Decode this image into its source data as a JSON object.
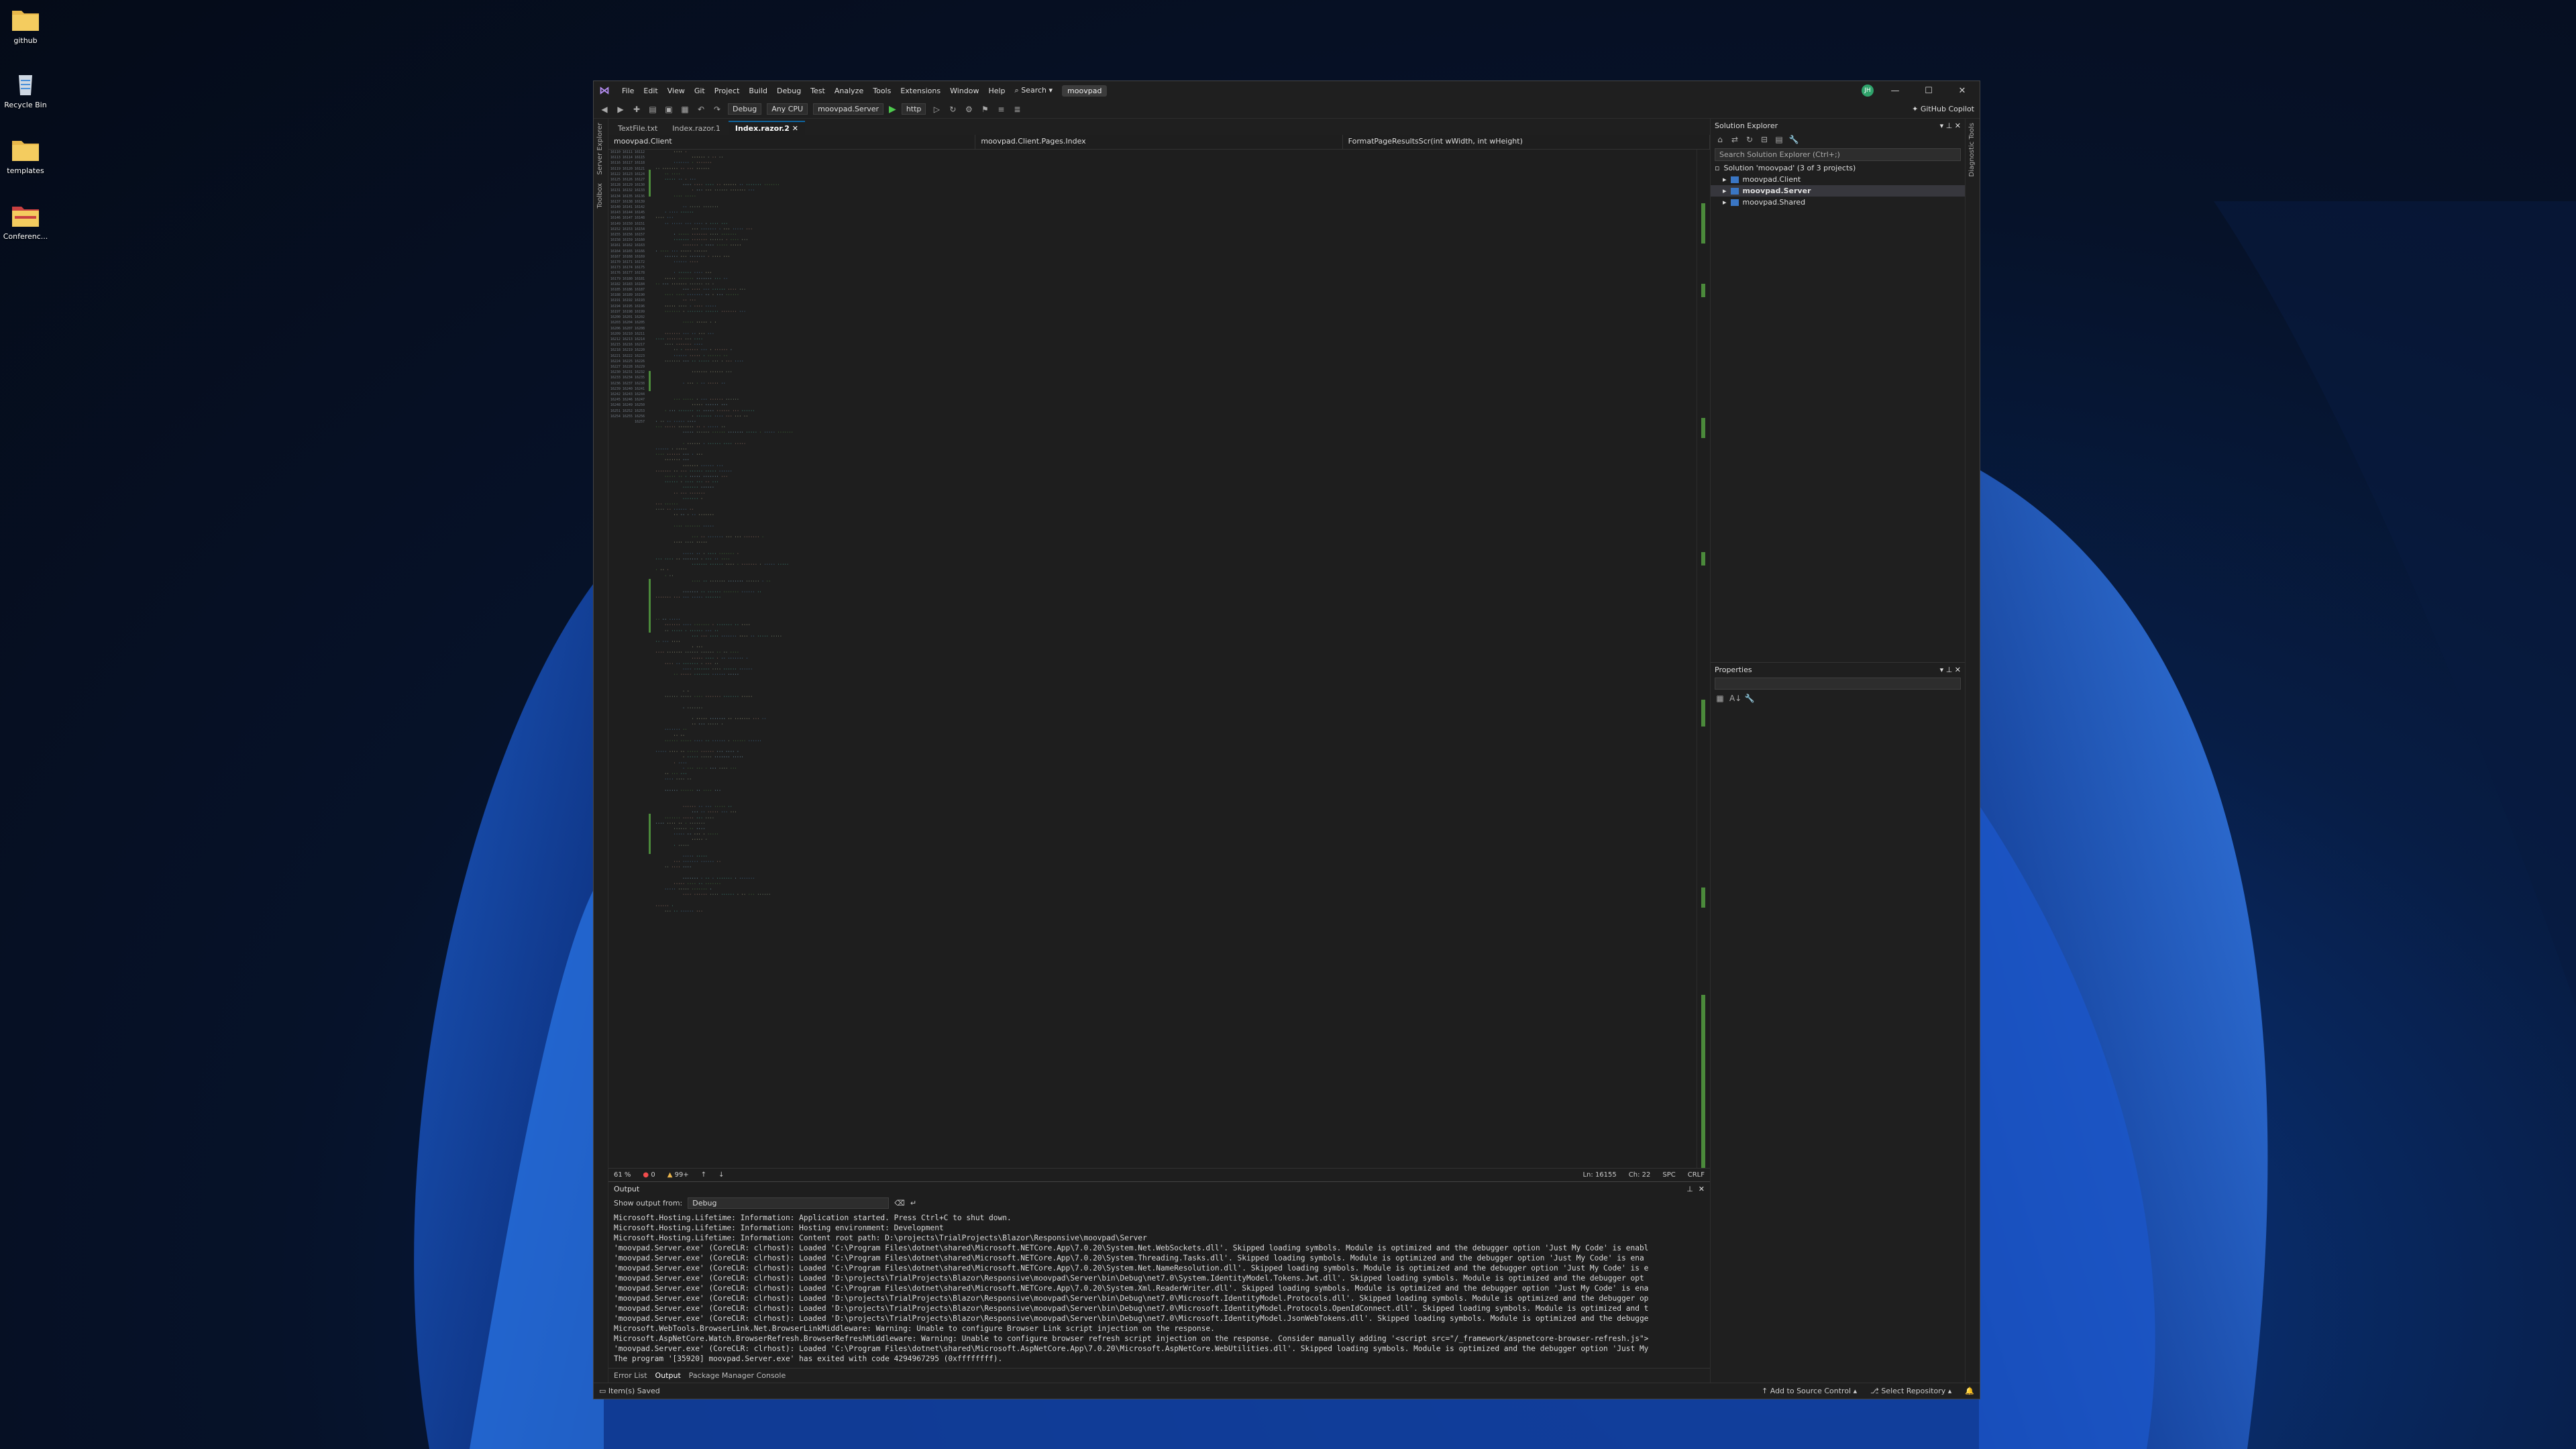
{
  "desktop": {
    "icons": [
      {
        "label": "github",
        "icon": "folder-icon"
      },
      {
        "label": "Recycle Bin",
        "icon": "recycle-bin-icon"
      },
      {
        "label": "templates",
        "icon": "folder-icon"
      },
      {
        "label": "Conferenc...",
        "icon": "folder-icon"
      }
    ]
  },
  "titlebar": {
    "menus": [
      "File",
      "Edit",
      "View",
      "Git",
      "Project",
      "Build",
      "Debug",
      "Test",
      "Analyze",
      "Tools",
      "Extensions",
      "Window",
      "Help"
    ],
    "search": "Search",
    "solution": "moovpad",
    "avatar": "JH"
  },
  "toolbar": {
    "config": "Debug",
    "platform": "Any CPU",
    "startup": "moovpad.Server",
    "launch": "http",
    "copilot": "GitHub Copilot"
  },
  "left_rail": [
    "Server Explorer",
    "Toolbox"
  ],
  "right_rail": [
    "Diagnostic Tools"
  ],
  "doc_tabs": [
    {
      "label": "TextFile.txt",
      "active": false
    },
    {
      "label": "Index.razor.1",
      "active": false
    },
    {
      "label": "Index.razor.2",
      "active": true
    }
  ],
  "navbar": {
    "project": "moovpad.Client",
    "type": "moovpad.Client.Pages.Index",
    "member": "FormatPageResultsScr(int wWidth, int wHeight)"
  },
  "editor": {
    "line_start": 16110,
    "status": {
      "zoom": "61 %",
      "errors": "0",
      "warnings": "99+",
      "position": "Ln: 16155",
      "column": "Ch: 22",
      "spacing": "SPC",
      "eol": "CRLF"
    }
  },
  "output": {
    "title": "Output",
    "show_from_label": "Show output from:",
    "show_from_value": "Debug",
    "lines": [
      "Microsoft.Hosting.Lifetime: Information: Application started. Press Ctrl+C to shut down.",
      "Microsoft.Hosting.Lifetime: Information: Hosting environment: Development",
      "Microsoft.Hosting.Lifetime: Information: Content root path: D:\\projects\\TrialProjects\\Blazor\\Responsive\\moovpad\\Server",
      "'moovpad.Server.exe' (CoreCLR: clrhost): Loaded 'C:\\Program Files\\dotnet\\shared\\Microsoft.NETCore.App\\7.0.20\\System.Net.WebSockets.dll'. Skipped loading symbols. Module is optimized and the debugger option 'Just My Code' is enabl",
      "'moovpad.Server.exe' (CoreCLR: clrhost): Loaded 'C:\\Program Files\\dotnet\\shared\\Microsoft.NETCore.App\\7.0.20\\System.Threading.Tasks.dll'. Skipped loading symbols. Module is optimized and the debugger option 'Just My Code' is ena",
      "'moovpad.Server.exe' (CoreCLR: clrhost): Loaded 'C:\\Program Files\\dotnet\\shared\\Microsoft.NETCore.App\\7.0.20\\System.Net.NameResolution.dll'. Skipped loading symbols. Module is optimized and the debugger option 'Just My Code' is e",
      "'moovpad.Server.exe' (CoreCLR: clrhost): Loaded 'D:\\projects\\TrialProjects\\Blazor\\Responsive\\moovpad\\Server\\bin\\Debug\\net7.0\\System.IdentityModel.Tokens.Jwt.dll'. Skipped loading symbols. Module is optimized and the debugger opt",
      "'moovpad.Server.exe' (CoreCLR: clrhost): Loaded 'C:\\Program Files\\dotnet\\shared\\Microsoft.NETCore.App\\7.0.20\\System.Xml.ReaderWriter.dll'. Skipped loading symbols. Module is optimized and the debugger option 'Just My Code' is ena",
      "'moovpad.Server.exe' (CoreCLR: clrhost): Loaded 'D:\\projects\\TrialProjects\\Blazor\\Responsive\\moovpad\\Server\\bin\\Debug\\net7.0\\Microsoft.IdentityModel.Protocols.dll'. Skipped loading symbols. Module is optimized and the debugger op",
      "'moovpad.Server.exe' (CoreCLR: clrhost): Loaded 'D:\\projects\\TrialProjects\\Blazor\\Responsive\\moovpad\\Server\\bin\\Debug\\net7.0\\Microsoft.IdentityModel.Protocols.OpenIdConnect.dll'. Skipped loading symbols. Module is optimized and t",
      "'moovpad.Server.exe' (CoreCLR: clrhost): Loaded 'D:\\projects\\TrialProjects\\Blazor\\Responsive\\moovpad\\Server\\bin\\Debug\\net7.0\\Microsoft.IdentityModel.JsonWebTokens.dll'. Skipped loading symbols. Module is optimized and the debugge",
      "Microsoft.WebTools.BrowserLink.Net.BrowserLinkMiddleware: Warning: Unable to configure Browser Link script injection on the response.",
      "Microsoft.AspNetCore.Watch.BrowserRefresh.BrowserRefreshMiddleware: Warning: Unable to configure browser refresh script injection on the response. Consider manually adding '<script src=\"/_framework/aspnetcore-browser-refresh.js\">",
      "'moovpad.Server.exe' (CoreCLR: clrhost): Loaded 'C:\\Program Files\\dotnet\\shared\\Microsoft.AspNetCore.App\\7.0.20\\Microsoft.AspNetCore.WebUtilities.dll'. Skipped loading symbols. Module is optimized and the debugger option 'Just My",
      "The program '[35920] moovpad.Server.exe' has exited with code 4294967295 (0xffffffff)."
    ]
  },
  "bottom_tabs": [
    "Error List",
    "Output",
    "Package Manager Console"
  ],
  "solution_explorer": {
    "title": "Solution Explorer",
    "search_placeholder": "Search Solution Explorer (Ctrl+;)",
    "solution_label": "Solution 'moovpad' (3 of 3 projects)",
    "projects": [
      "moovpad.Client",
      "moovpad.Server",
      "moovpad.Shared"
    ],
    "selected": "moovpad.Server"
  },
  "properties": {
    "title": "Properties"
  },
  "statusbar": {
    "left": "Item(s) Saved",
    "source_control": "Add to Source Control",
    "repo": "Select Repository"
  }
}
